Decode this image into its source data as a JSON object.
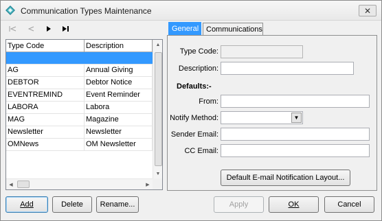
{
  "window": {
    "title": "Communication Types Maintenance",
    "close_glyph": "✕"
  },
  "list": {
    "columns": [
      "Type Code",
      "Description"
    ],
    "rows": [
      [
        "",
        ""
      ],
      [
        "AG",
        "Annual Giving"
      ],
      [
        "DEBTOR",
        "Debtor Notice"
      ],
      [
        "EVENTREMIND",
        "Event Reminder"
      ],
      [
        "LABORA",
        "Labora"
      ],
      [
        "MAG",
        "Magazine"
      ],
      [
        "Newsletter",
        "Newsletter"
      ],
      [
        "OMNews",
        "OM Newsletter"
      ]
    ]
  },
  "tabs": [
    "General",
    "Communications"
  ],
  "form": {
    "type_code_label": "Type Code:",
    "type_code_value": "",
    "description_label": "Description:",
    "description_value": "",
    "defaults_heading": "Defaults:-",
    "from_label": "From:",
    "from_value": "",
    "notify_method_label": "Notify Method:",
    "notify_method_value": "",
    "sender_email_label": "Sender Email:",
    "sender_email_value": "",
    "cc_email_label": "CC Email:",
    "cc_email_value": "",
    "layout_button": "Default E-mail Notification Layout..."
  },
  "buttons": {
    "add": "Add",
    "delete": "Delete",
    "rename": "Rename...",
    "apply": "Apply",
    "ok": "OK",
    "cancel": "Cancel"
  },
  "colors": {
    "selection": "#3399ff",
    "accent": "#3399ff"
  }
}
